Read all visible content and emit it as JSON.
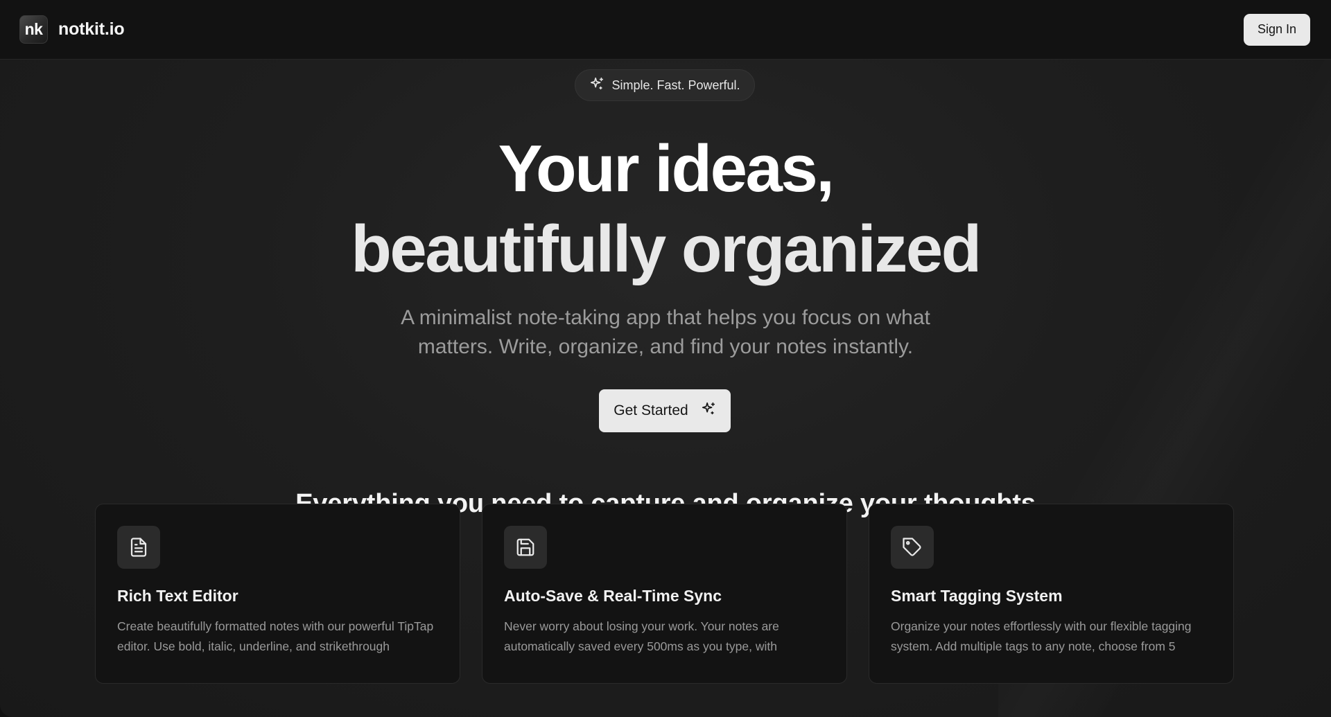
{
  "header": {
    "logo_text": "nk",
    "brand_name": "notkit.io",
    "signin_label": "Sign In"
  },
  "hero": {
    "pill_icon": "sparkles-icon",
    "pill_text": "Simple. Fast. Powerful.",
    "headline_line1": "Your ideas,",
    "headline_line2": "beautifully organized",
    "subtitle": "A minimalist note-taking app that helps you focus on what matters. Write, organize, and find your notes instantly.",
    "cta_label": "Get Started",
    "cta_icon": "sparkles-icon"
  },
  "features": {
    "section_title": "Everything you need to capture and organize your thoughts",
    "cards": [
      {
        "icon": "file-text-icon",
        "title": "Rich Text Editor",
        "description": "Create beautifully formatted notes with our powerful TipTap editor. Use bold, italic, underline, and strikethrough"
      },
      {
        "icon": "save-icon",
        "title": "Auto-Save & Real-Time Sync",
        "description": "Never worry about losing your work. Your notes are automatically saved every 500ms as you type, with"
      },
      {
        "icon": "tag-icon",
        "title": "Smart Tagging System",
        "description": "Organize your notes effortlessly with our flexible tagging system. Add multiple tags to any note, choose from 5"
      }
    ]
  },
  "colors": {
    "background": "#111111",
    "surface": "#1e1e1e",
    "button_bg": "#e9e9e9",
    "text_primary": "#ffffff",
    "text_muted": "#9c9c9c"
  }
}
